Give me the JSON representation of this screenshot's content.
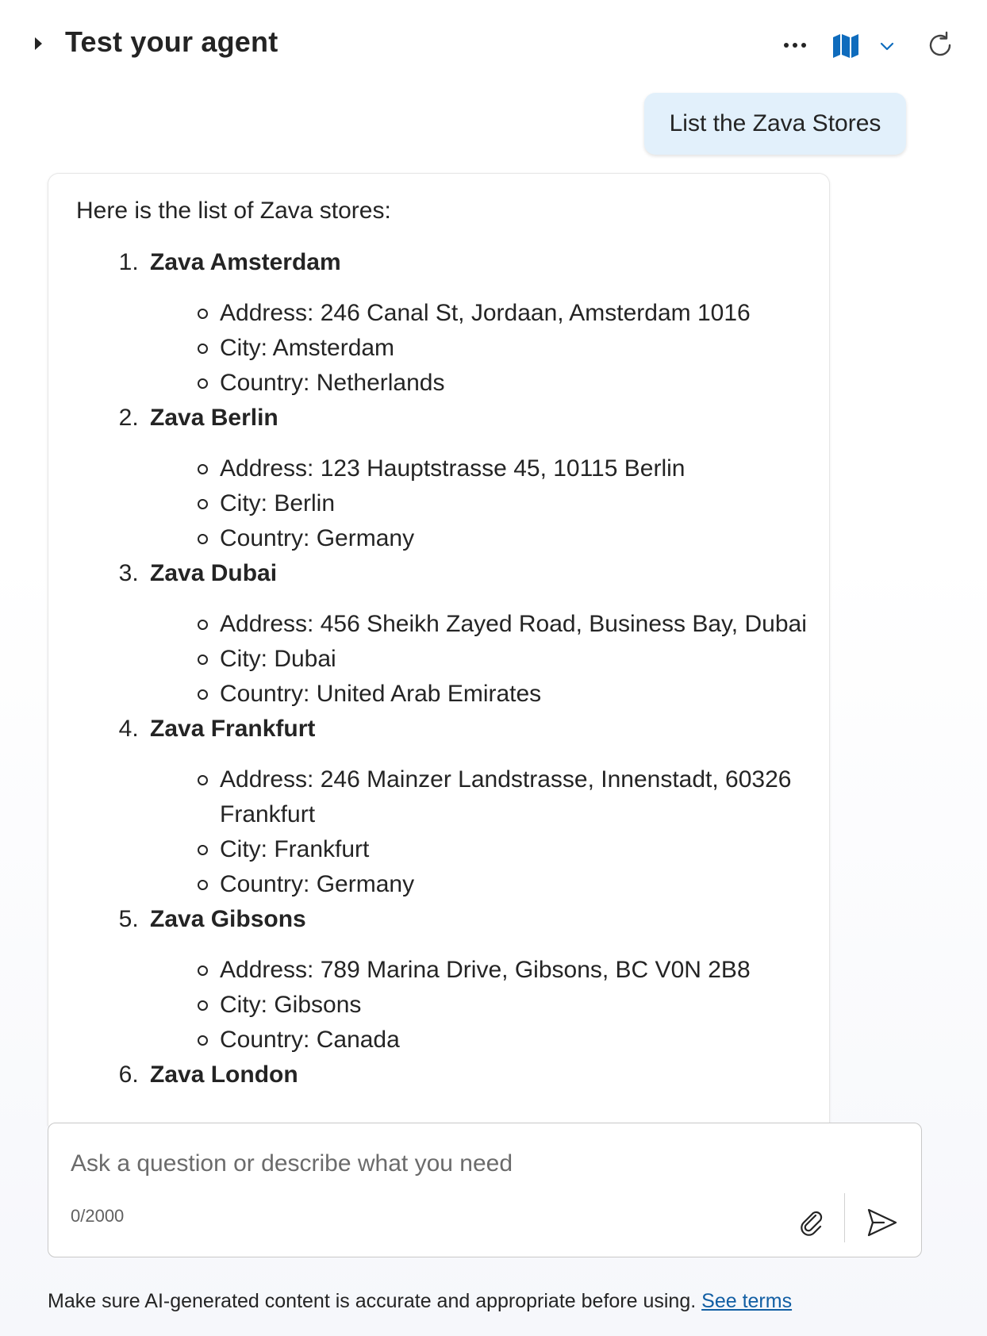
{
  "header": {
    "title": "Test your agent",
    "more_icon": "more-horizontal-icon",
    "map_icon": "map-icon",
    "chevron_icon": "chevron-down-icon",
    "refresh_icon": "refresh-icon",
    "accent_color": "#0f6cbd"
  },
  "conversation": {
    "user_message": "List the Zava Stores",
    "bot_intro": "Here is the list of Zava stores:",
    "stores": [
      {
        "number": "1.",
        "name": "Zava Amsterdam",
        "details": [
          "Address: 246 Canal St, Jordaan, Amsterdam 1016",
          "City: Amsterdam",
          "Country: Netherlands"
        ]
      },
      {
        "number": "2.",
        "name": "Zava Berlin",
        "details": [
          "Address: 123 Hauptstrasse 45, 10115 Berlin",
          "City: Berlin",
          "Country: Germany"
        ]
      },
      {
        "number": "3.",
        "name": "Zava Dubai",
        "details": [
          "Address: 456 Sheikh Zayed Road, Business Bay, Dubai",
          "City: Dubai",
          "Country: United Arab Emirates"
        ]
      },
      {
        "number": "4.",
        "name": "Zava Frankfurt",
        "details": [
          "Address: 246 Mainzer Landstrasse, Innenstadt, 60326 Frankfurt",
          "City: Frankfurt",
          "Country: Germany"
        ]
      },
      {
        "number": "5.",
        "name": "Zava Gibsons",
        "details": [
          "Address: 789 Marina Drive, Gibsons, BC V0N 2B8",
          "City: Gibsons",
          "Country: Canada"
        ]
      },
      {
        "number": "6.",
        "name": "Zava London",
        "details": []
      }
    ]
  },
  "composer": {
    "placeholder": "Ask a question or describe what you need",
    "value": "",
    "counter": "0/2000",
    "attach_icon": "attach-icon",
    "send_icon": "send-icon"
  },
  "footer": {
    "disclaimer": "Make sure AI-generated content is accurate and appropriate before using.",
    "terms_link": "See terms",
    "link_color": "#115ea3"
  }
}
